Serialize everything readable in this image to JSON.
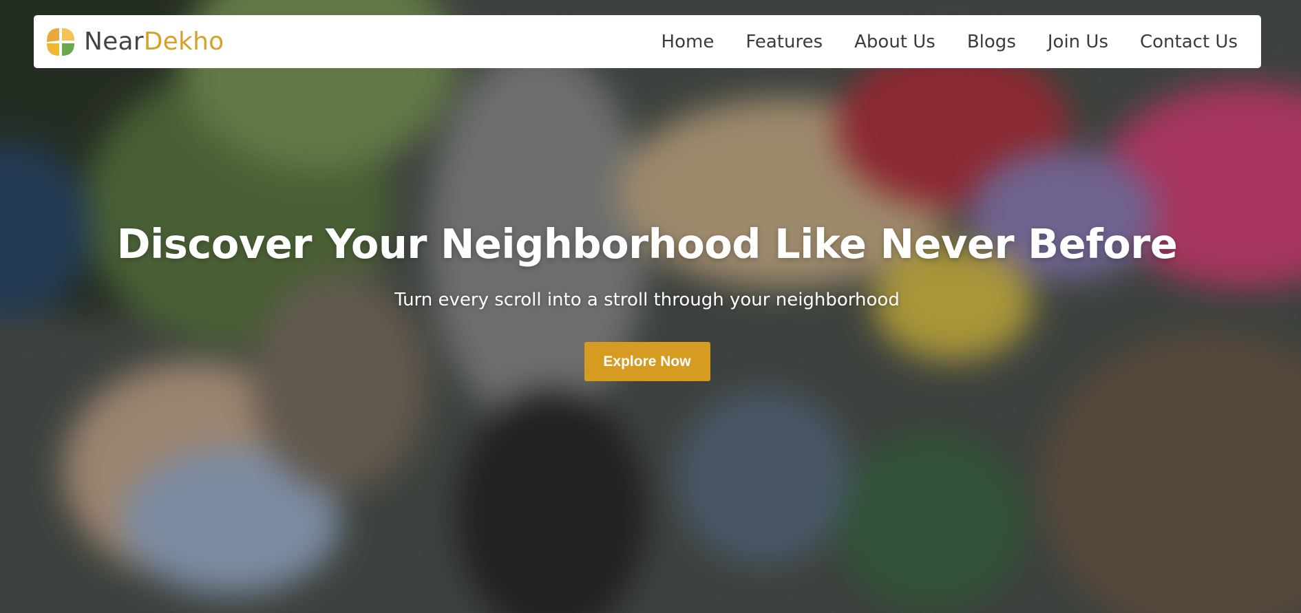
{
  "brand": {
    "name_part1": "Near",
    "name_part2": "Dekho",
    "logo_icon": "neardekho-logo-icon"
  },
  "nav": {
    "items": [
      {
        "label": "Home"
      },
      {
        "label": "Features"
      },
      {
        "label": "About Us"
      },
      {
        "label": "Blogs"
      },
      {
        "label": "Join Us"
      },
      {
        "label": "Contact Us"
      }
    ]
  },
  "hero": {
    "title": "Discover Your Neighborhood Like Never Before",
    "subtitle": "Turn every scroll into a stroll through your neighborhood",
    "cta_label": "Explore Now",
    "background": "blurred street market photo"
  },
  "colors": {
    "accent": "#d69c22",
    "brand_gold": "#d6a12a",
    "brand_gray": "#444444",
    "logo_green": "#6aa84f",
    "navbar_bg": "#ffffff",
    "hero_text": "#ffffff"
  }
}
